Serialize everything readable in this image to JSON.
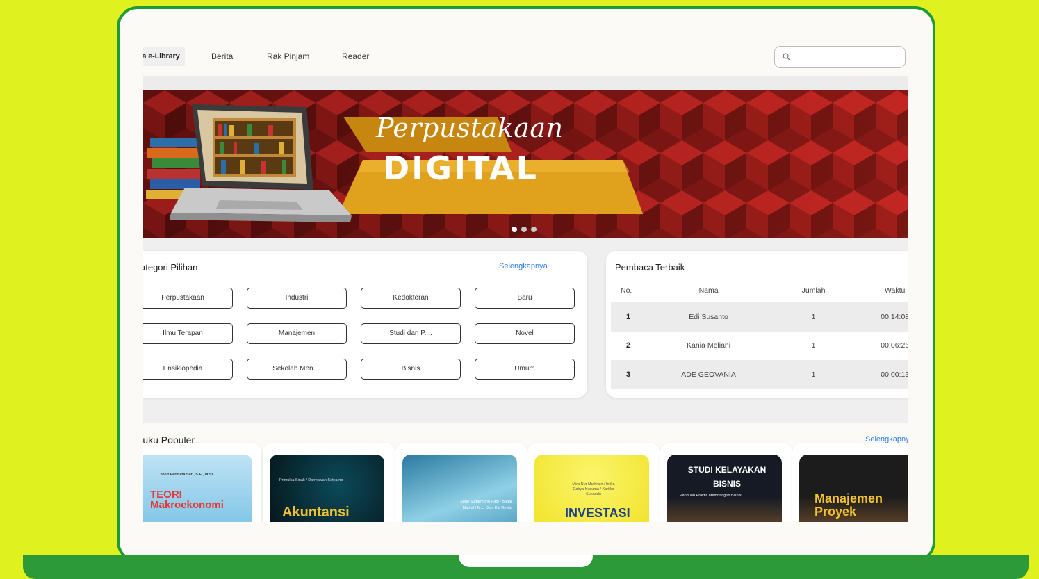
{
  "nav": {
    "brand": "ana e-Library",
    "links": [
      "Berita",
      "Rak Pinjam",
      "Reader"
    ],
    "search_placeholder": ""
  },
  "hero": {
    "script_text": "Perpustakaan",
    "title": "DIGITAL",
    "slides": 3,
    "active_slide": 1
  },
  "kategori": {
    "title": "ategori Pilihan",
    "more": "Selengkapnya",
    "items": [
      "Perpustakaan",
      "Industri",
      "Kedokteran",
      "Baru",
      "Ilmu Terapan",
      "Manajemen",
      "Studi dan P....",
      "Novel",
      "Ensiklopedia",
      "Sekolah Men....",
      "Bisnis",
      "Umum"
    ]
  },
  "pembaca": {
    "title": "Pembaca Terbaik",
    "headers": [
      "No.",
      "Nama",
      "Jumlah",
      "Waktu"
    ],
    "rows": [
      {
        "no": "1",
        "nama": "Edi Susanto",
        "jumlah": "1",
        "waktu": "00:14:08"
      },
      {
        "no": "2",
        "nama": "Kania Meliani",
        "jumlah": "1",
        "waktu": "00:06:26"
      },
      {
        "no": "3",
        "nama": "ADE GEOVANIA",
        "jumlah": "1",
        "waktu": "00:00:13"
      }
    ]
  },
  "populer": {
    "title": "Buku Populer",
    "more": "Selengkapnya",
    "books": [
      {
        "title": "TEORI Makroekonomi",
        "author": "Yollit Permata Sari, S.E., M.Si."
      },
      {
        "title": "Akuntansi",
        "author": "Primulsa Sinalt / Darmawan Setyarno"
      },
      {
        "title": "",
        "author": "Sono Sudarmono Hadi / Badar Murifal / M.L. Dian Ela Revita"
      },
      {
        "title": "INVESTASI",
        "author": "Mira Nur Muthrain / Indra Cahya Kusuma / Kartika Sukandu"
      },
      {
        "title": "STUDI KELAYAKAN BISNIS",
        "author": "Panduan Praktis Membangun Bisnis"
      },
      {
        "title": "Manajemen Proyek",
        "author": ""
      }
    ]
  },
  "colors": {
    "background": "#dff21f",
    "frame_green": "#1f9a34",
    "base_green": "#2d9a3a",
    "link_blue": "#2f7fe8",
    "hero_red": "#9c1c1a",
    "banner_gold": "#e0a21c"
  }
}
